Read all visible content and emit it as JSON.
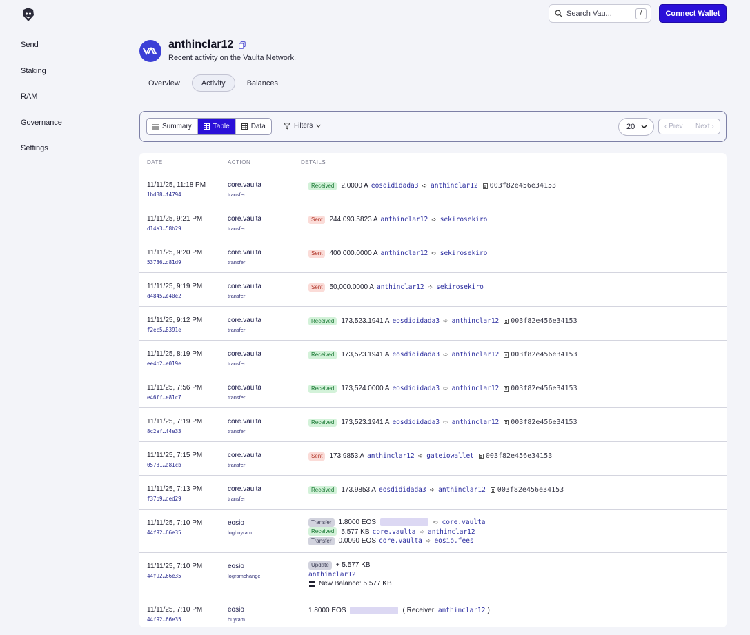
{
  "sidebar": {
    "items": [
      "Send",
      "Staking",
      "RAM",
      "Governance",
      "Settings"
    ]
  },
  "header": {
    "search_placeholder": "Search Vau...",
    "search_shortcut": "/",
    "connect_label": "Connect Wallet"
  },
  "account": {
    "name": "anthinclar12",
    "subtitle": "Recent activity on the Vaulta Network."
  },
  "tabs": [
    "Overview",
    "Activity",
    "Balances"
  ],
  "active_tab": "Activity",
  "toolbar": {
    "views": [
      "Summary",
      "Table",
      "Data"
    ],
    "active_view": "Table",
    "filters_label": "Filters",
    "page_size": "20",
    "prev_label": "Prev",
    "next_label": "Next"
  },
  "table": {
    "columns": [
      "DATE",
      "ACTION",
      "DETAILS"
    ],
    "rows": [
      {
        "date": "11/11/25, 11:18 PM",
        "tx": "1bd38…f4794",
        "contract": "core.vaulta",
        "action": "transfer",
        "badge": "Received",
        "amount": "2.0000 A",
        "from": "eosdididada3",
        "to": "anthinclar12",
        "memo": "003f82e456e34153"
      },
      {
        "date": "11/11/25, 9:21 PM",
        "tx": "d14a3…58b29",
        "contract": "core.vaulta",
        "action": "transfer",
        "badge": "Sent",
        "amount": "244,093.5823 A",
        "from": "anthinclar12",
        "to": "sekirosekiro",
        "memo": ""
      },
      {
        "date": "11/11/25, 9:20 PM",
        "tx": "53736…d81d9",
        "contract": "core.vaulta",
        "action": "transfer",
        "badge": "Sent",
        "amount": "400,000.0000 A",
        "from": "anthinclar12",
        "to": "sekirosekiro",
        "memo": ""
      },
      {
        "date": "11/11/25, 9:19 PM",
        "tx": "d4845…e40e2",
        "contract": "core.vaulta",
        "action": "transfer",
        "badge": "Sent",
        "amount": "50,000.0000 A",
        "from": "anthinclar12",
        "to": "sekirosekiro",
        "memo": ""
      },
      {
        "date": "11/11/25, 9:12 PM",
        "tx": "f2ec5…8391e",
        "contract": "core.vaulta",
        "action": "transfer",
        "badge": "Received",
        "amount": "173,523.1941 A",
        "from": "eosdididada3",
        "to": "anthinclar12",
        "memo": "003f82e456e34153"
      },
      {
        "date": "11/11/25, 8:19 PM",
        "tx": "ee4b2…e019e",
        "contract": "core.vaulta",
        "action": "transfer",
        "badge": "Received",
        "amount": "173,523.1941 A",
        "from": "eosdididada3",
        "to": "anthinclar12",
        "memo": "003f82e456e34153"
      },
      {
        "date": "11/11/25, 7:56 PM",
        "tx": "e46ff…e81c7",
        "contract": "core.vaulta",
        "action": "transfer",
        "badge": "Received",
        "amount": "173,524.0000 A",
        "from": "eosdididada3",
        "to": "anthinclar12",
        "memo": "003f82e456e34153"
      },
      {
        "date": "11/11/25, 7:19 PM",
        "tx": "8c2af…f4e33",
        "contract": "core.vaulta",
        "action": "transfer",
        "badge": "Received",
        "amount": "173,523.1941 A",
        "from": "eosdididada3",
        "to": "anthinclar12",
        "memo": "003f82e456e34153"
      },
      {
        "date": "11/11/25, 7:15 PM",
        "tx": "05731…a81cb",
        "contract": "core.vaulta",
        "action": "transfer",
        "badge": "Sent",
        "amount": "173.9853 A",
        "from": "anthinclar12",
        "to": "gateiowallet",
        "memo": "003f82e456e34153"
      },
      {
        "date": "11/11/25, 7:13 PM",
        "tx": "f37b9…ded29",
        "contract": "core.vaulta",
        "action": "transfer",
        "badge": "Received",
        "amount": "173.9853 A",
        "from": "eosdididada3",
        "to": "anthinclar12",
        "memo": "003f82e456e34153"
      }
    ],
    "buyram_row": {
      "date": "11/11/25, 7:10 PM",
      "tx": "44f92…66e35",
      "contract": "eosio",
      "action": "logbuyram",
      "lines": [
        {
          "badge": "Transfer",
          "amount": "1.8000 EOS",
          "from": "",
          "to": "core.vaulta"
        },
        {
          "badge": "Received",
          "amount": "5.577 KB",
          "from": "core.vaulta",
          "to": "anthinclar12"
        },
        {
          "badge": "Transfer",
          "amount": "0.0090 EOS",
          "from": "core.vaulta",
          "to": "eosio.fees"
        }
      ]
    },
    "ramchange_row": {
      "date": "11/11/25, 7:10 PM",
      "tx": "44f92…66e35",
      "contract": "eosio",
      "action": "logramchange",
      "badge": "Update",
      "delta": "+ 5.577 KB",
      "account": "anthinclar12",
      "balance": "New Balance: 5.577 KB"
    },
    "final_row": {
      "date": "11/11/25, 7:10 PM",
      "tx": "44f92…66e35",
      "contract": "eosio",
      "action": "buyram",
      "amount": "1.8000 EOS",
      "receiver_prefix": "( Receiver:",
      "receiver": "anthinclar12",
      "receiver_suffix": ")"
    }
  }
}
